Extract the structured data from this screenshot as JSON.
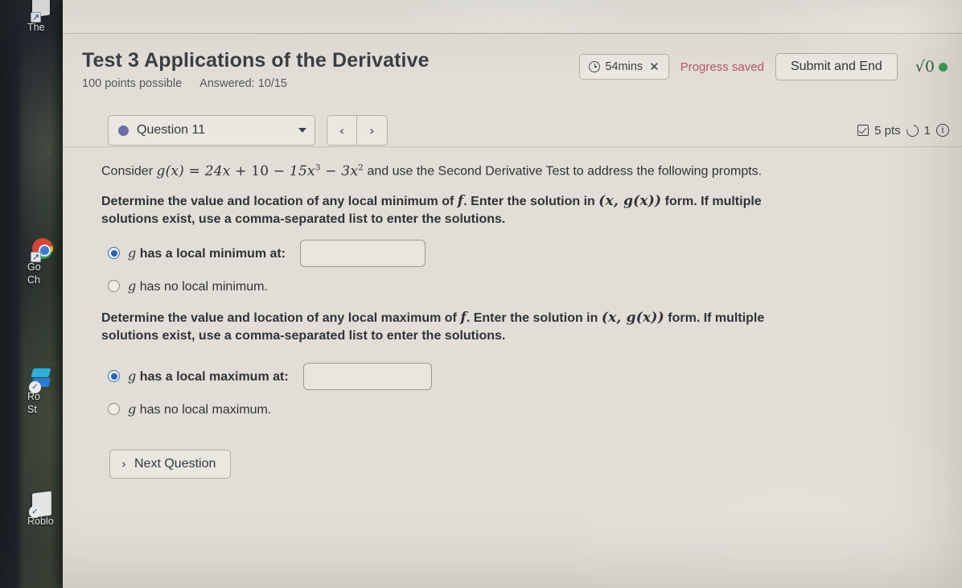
{
  "desktop": {
    "icons": [
      {
        "name": "the-shortcut",
        "label": "The",
        "glyph": "shortcut-arrow-icon"
      },
      {
        "name": "google-chrome",
        "label": "Go\nCh",
        "label_line1": "Go",
        "label_line2": "Ch",
        "glyph": "chrome-icon"
      },
      {
        "name": "roblox-studio",
        "label_line1": "Ro",
        "label_line2": "St",
        "glyph": "roblox-studio-icon"
      },
      {
        "name": "roblox",
        "label_line1": "Roblo",
        "glyph": "roblox-icon"
      }
    ]
  },
  "header": {
    "title": "Test 3 Applications of the Derivative",
    "points_possible": "100 points possible",
    "answered": "Answered: 10/15",
    "timer": "54mins",
    "timer_close": "✕",
    "progress_saved": "Progress saved",
    "submit_label": "Submit and End",
    "sqrt_tool": "√0",
    "icons": {
      "clock": "clock-icon",
      "green_status": "green-dot-icon"
    },
    "colors": {
      "progress_saved": "#b3576b",
      "sqrt_tool": "#2f5d3a",
      "status_dot": "#3a9b52"
    }
  },
  "qnav": {
    "question_label": "Question 11",
    "dropdown_icon": "chevron-down-icon",
    "prev_icon": "‹",
    "next_icon": "›",
    "points": "5 pts",
    "attempts": "1",
    "checkbox_icon": "checkbox-checked-icon",
    "retry_icon": "retry-icon",
    "info_icon": "info-icon",
    "dot_color": "#6b6fa8"
  },
  "question": {
    "intro_prefix": "Consider ",
    "function_tex": {
      "lhs": "g(x)",
      "eq": "=",
      "t1": "24x",
      "p1": "+",
      "t2": "10",
      "p2": "−",
      "t3": "15x",
      "t3_exp": "3",
      "p3": "−",
      "t4": "3x",
      "t4_exp": "2"
    },
    "intro_suffix": " and use the Second Derivative Test to address the following prompts.",
    "min_prompt_a": "Determine the value and location of any local minimum of ",
    "min_prompt_f": "f",
    "min_prompt_b": ". Enter the solution in ",
    "form_tex": "(x, g(x))",
    "min_prompt_c": " form. If multiple solutions exist, use a comma-separated list to enter the solutions.",
    "max_prompt_a": "Determine the value and location of any local maximum of ",
    "max_prompt_f": "f",
    "max_prompt_b": ". Enter the solution in ",
    "max_prompt_c": " form. If multiple solutions exist, use a comma-separated list to enter the solutions.",
    "choices": {
      "min_has": "has a local minimum at:",
      "min_none": "has no local minimum.",
      "max_has": "has a local maximum at:",
      "max_none": "has no local maximum.",
      "var": "g"
    },
    "min_answer_value": "",
    "max_answer_value": "",
    "min_selected": "has-minimum",
    "max_selected": "has-maximum",
    "next_question_label": "Next Question",
    "next_question_icon": "chevron-right-icon"
  }
}
